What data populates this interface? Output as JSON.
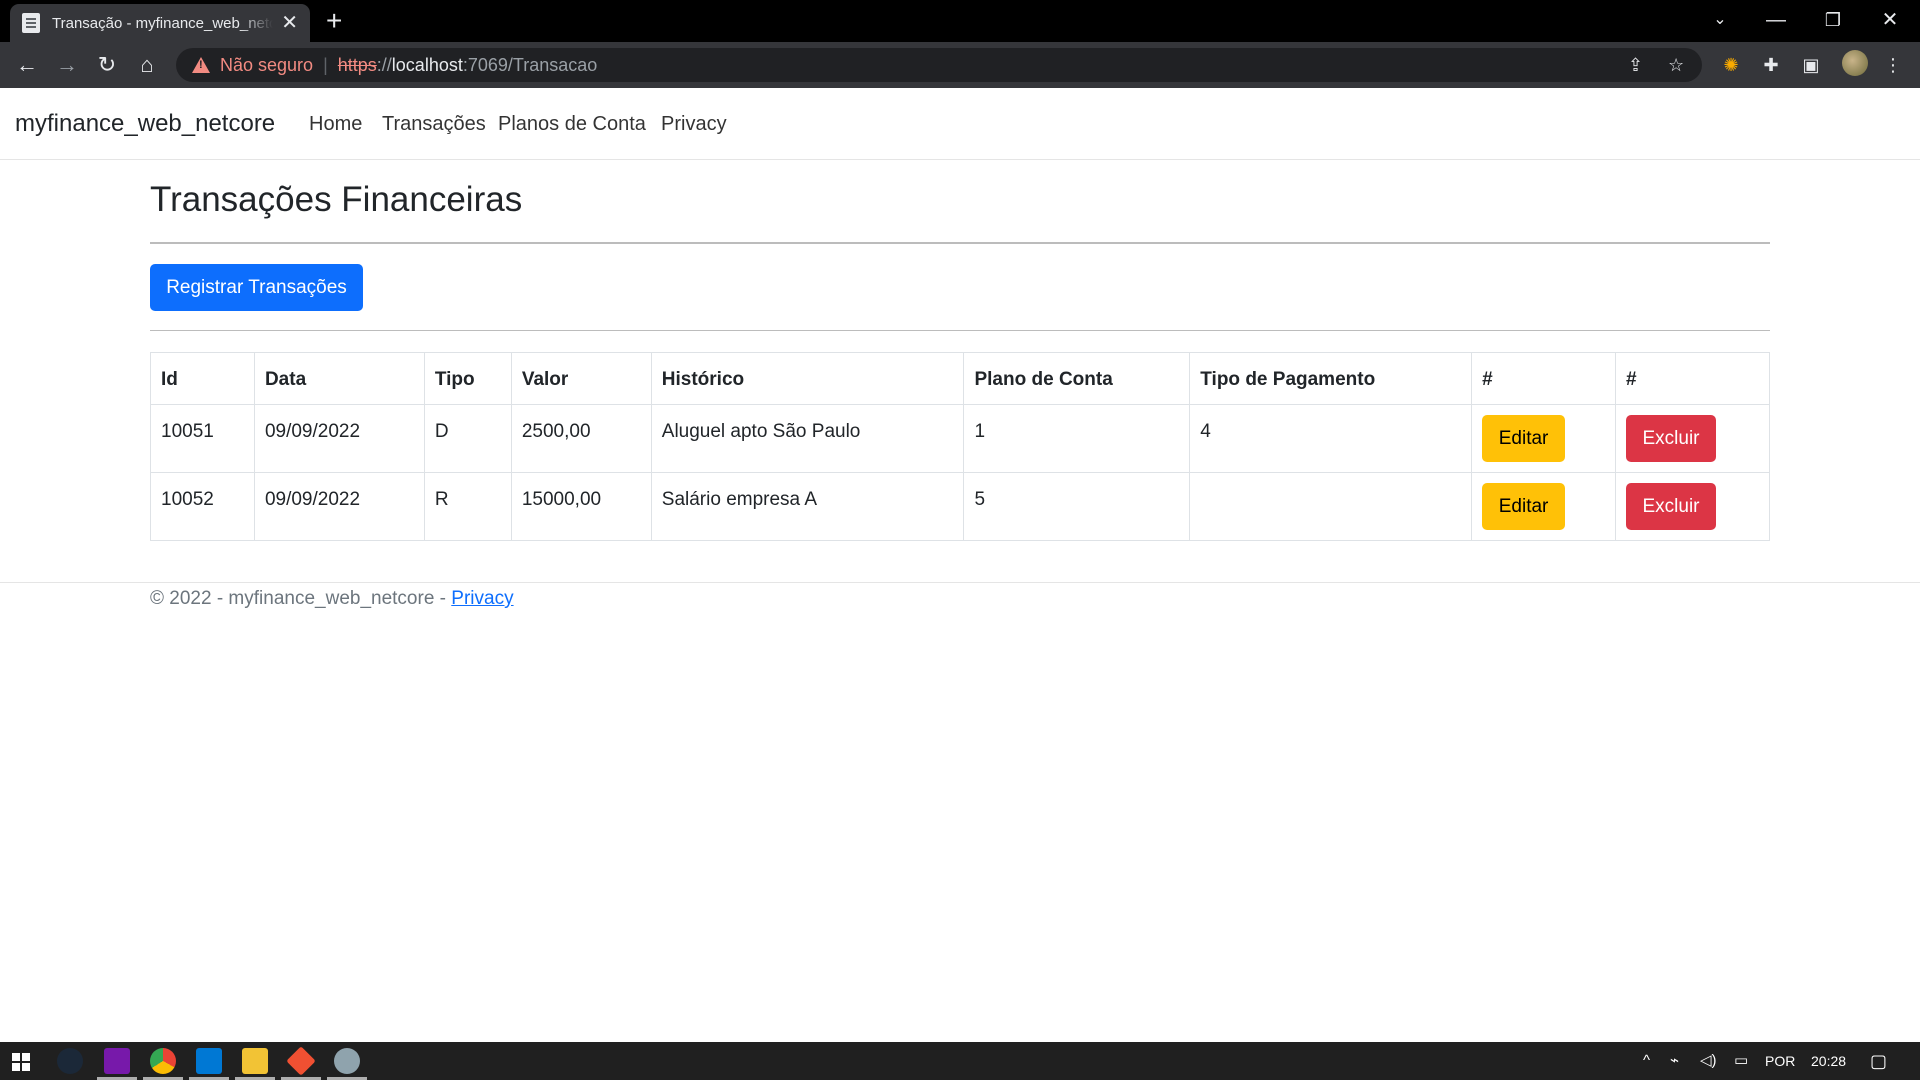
{
  "browser": {
    "tab_title": "Transação - myfinance_web_netcore",
    "url_warning": "Não seguro",
    "url_scheme": "https",
    "url_sep": "://",
    "url_host": "localhost",
    "url_rest": ":7069/Transacao"
  },
  "nav": {
    "brand": "myfinance_web_netcore",
    "links": [
      "Home",
      "Transações",
      "Planos de Conta",
      "Privacy"
    ]
  },
  "page": {
    "title": "Transações Financeiras",
    "register_button": "Registrar Transações"
  },
  "table": {
    "headers": [
      "Id",
      "Data",
      "Tipo",
      "Valor",
      "Histórico",
      "Plano de Conta",
      "Tipo de Pagamento",
      "#",
      "#"
    ],
    "rows": [
      {
        "id": "10051",
        "data": "09/09/2022",
        "tipo": "D",
        "valor": "2500,00",
        "historico": "Aluguel apto São Paulo",
        "plano": "1",
        "pagamento": "4",
        "edit": "Editar",
        "delete": "Excluir"
      },
      {
        "id": "10052",
        "data": "09/09/2022",
        "tipo": "R",
        "valor": "15000,00",
        "historico": "Salário empresa A",
        "plano": "5",
        "pagamento": "",
        "edit": "Editar",
        "delete": "Excluir"
      }
    ]
  },
  "footer": {
    "text": "© 2022 - myfinance_web_netcore - ",
    "link": "Privacy"
  },
  "taskbar": {
    "language": "POR",
    "time": "20:28"
  },
  "colors": {
    "primary": "#0d6efd",
    "warning": "#ffc107",
    "danger": "#dc3545",
    "insecure": "#f28b82"
  }
}
